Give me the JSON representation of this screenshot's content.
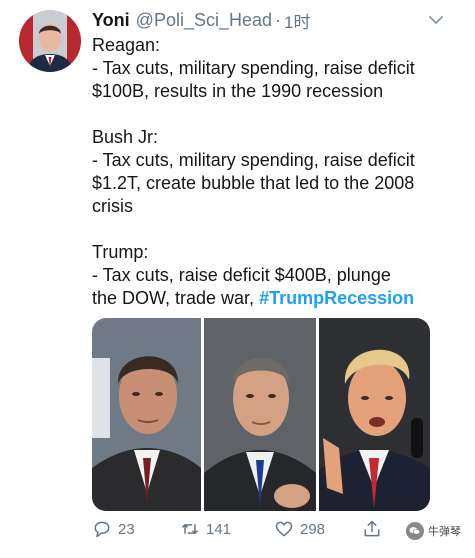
{
  "tweet": {
    "display_name": "Yoni",
    "handle": "@Poli_Sci_Head",
    "separator": "·",
    "time": "1时",
    "paragraphs": [
      [
        "Reagan:",
        "- Tax cuts, military spending, raise deficit",
        "$100B, results in the 1990 recession"
      ],
      [
        "Bush Jr:",
        "- Tax cuts, military spending, raise deficit",
        "$1.2T, create bubble that led to the 2008",
        "crisis"
      ],
      [
        "Trump:",
        "- Tax cuts, raise deficit $400B, plunge"
      ]
    ],
    "last_line_prefix": "the DOW, trade war, ",
    "hashtag": "#TrumpRecession",
    "photos": [
      "reagan-photo",
      "bush-photo",
      "trump-photo"
    ]
  },
  "actions": {
    "replies": "23",
    "retweets": "141",
    "likes": "298"
  },
  "watermark": {
    "text": "牛弹琴"
  },
  "colors": {
    "link": "#1da1f2",
    "muted": "#657786"
  }
}
